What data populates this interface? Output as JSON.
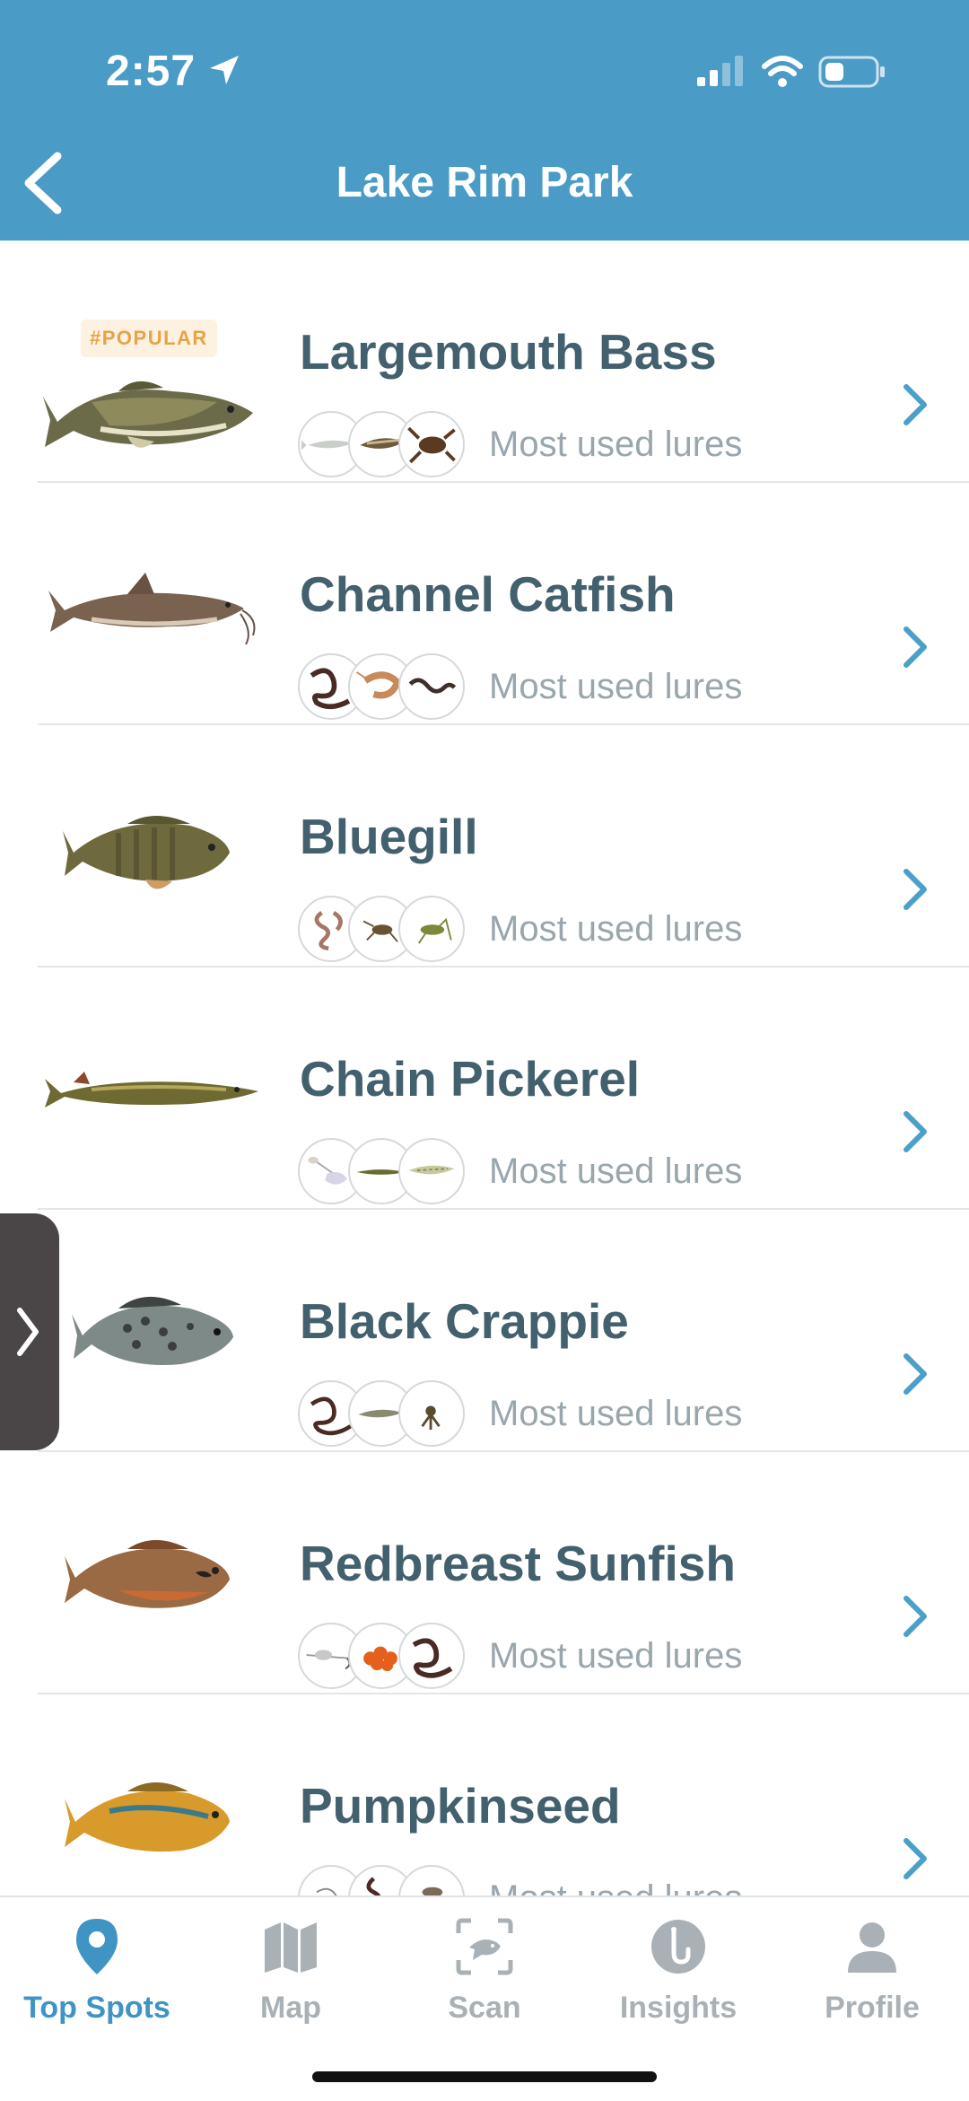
{
  "status_bar": {
    "time": "2:57"
  },
  "header": {
    "title": "Lake Rim Park"
  },
  "colors": {
    "header_bg": "#4a9bc5",
    "accent": "#3f94c4",
    "title_text": "#43606e",
    "muted_text": "#9aa6ad",
    "popular_text": "#e6a34a"
  },
  "list": {
    "rows": [
      {
        "name": "Largemouth Bass",
        "badge": "#POPULAR",
        "lures_label": "Most used lures"
      },
      {
        "name": "Channel Catfish",
        "lures_label": "Most used lures"
      },
      {
        "name": "Bluegill",
        "lures_label": "Most used lures"
      },
      {
        "name": "Chain Pickerel",
        "lures_label": "Most used lures"
      },
      {
        "name": "Black Crappie",
        "lures_label": "Most used lures"
      },
      {
        "name": "Redbreast Sunfish",
        "lures_label": "Most used lures"
      },
      {
        "name": "Pumpkinseed",
        "lures_label": "Most used lures"
      }
    ]
  },
  "tabbar": {
    "tabs": [
      {
        "label": "Top Spots",
        "icon": "location-pin-icon",
        "active": true
      },
      {
        "label": "Map",
        "icon": "map-icon"
      },
      {
        "label": "Scan",
        "icon": "scan-fish-icon"
      },
      {
        "label": "Insights",
        "icon": "hook-icon"
      },
      {
        "label": "Profile",
        "icon": "person-icon"
      }
    ]
  }
}
